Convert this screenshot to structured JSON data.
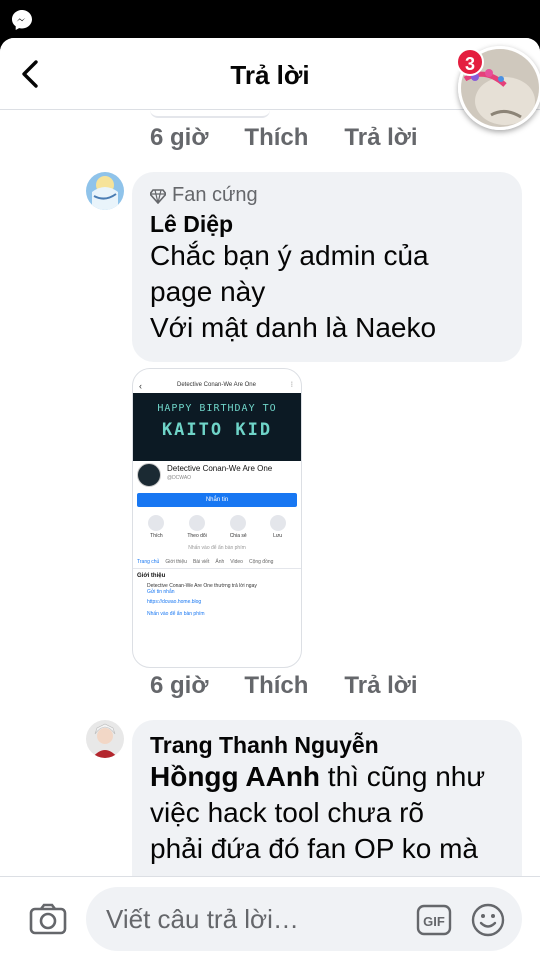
{
  "header": {
    "title": "Trả lời"
  },
  "chathead": {
    "badge": "3"
  },
  "comment1": {
    "time": "6 giờ",
    "like": "Thích",
    "reply": "Trả lời"
  },
  "comment2": {
    "badge": "Fan cứng",
    "author": "Lê Diệp",
    "lines": [
      "Chắc bạn ý admin của",
      "page này",
      "Với mật danh là Naeko"
    ],
    "time": "6 giờ",
    "like": "Thích",
    "reply": "Trả lời"
  },
  "attachment": {
    "topbar_title": "Detective Conan-We Are One",
    "banner_line1": "HAPPY BIRTHDAY TO",
    "banner_line2": "KAITO KID",
    "page_name": "Detective Conan-We Are One",
    "page_handle": "@DCWAO",
    "message_btn": "Nhắn tin",
    "icons": [
      "Thích",
      "Theo dõi",
      "Chia sẻ",
      "Lưu"
    ],
    "hidden_text": "Nhấn vào để ẩn bàn phím",
    "tabs": [
      "Trang chủ",
      "Giới thiệu",
      "Bài viết",
      "Ảnh",
      "Video",
      "Cộng đồng"
    ],
    "intro_title": "Giới thiệu",
    "intro_line": "Detective Conan-We Are One thường trả lời ngay",
    "intro_link": "Gửi tin nhắn",
    "url": "https://dcwao.home.blog",
    "bottom": "Nhấn vào để ẩn bàn phím"
  },
  "comment3": {
    "author": "Trang Thanh Nguyễn",
    "mention": "Hồngg AAnh",
    "line1_rest": " thì cũng như",
    "line2": "việc hack tool chưa rõ",
    "line3": "phải đứa đó fan OP ko mà"
  },
  "composer": {
    "placeholder": "Viết câu trả lời…",
    "gif": "GIF"
  }
}
